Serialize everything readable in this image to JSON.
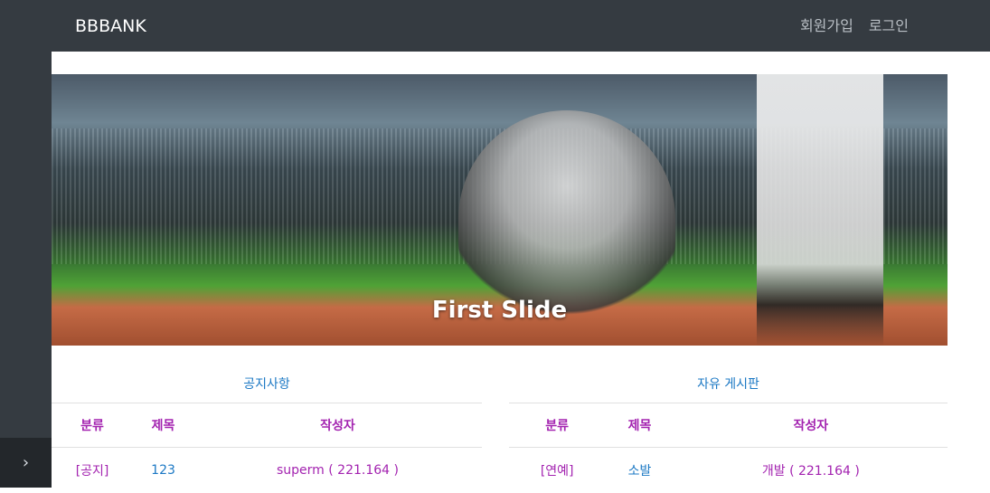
{
  "navbar": {
    "brand": "BBBANK",
    "links": [
      "회원가입",
      "로그인"
    ]
  },
  "sidebar": {
    "toggle_icon": "chevron-right-icon",
    "toggle_glyph": "›"
  },
  "carousel": {
    "caption": "First Slide"
  },
  "boards": [
    {
      "title": "공지사항",
      "columns": [
        "분류",
        "제목",
        "작성자"
      ],
      "rows": [
        {
          "category": "[공지]",
          "title": "123",
          "author": "superm ( 221.164 )"
        }
      ]
    },
    {
      "title": "자유 게시판",
      "columns": [
        "분류",
        "제목",
        "작성자"
      ],
      "rows": [
        {
          "category": "[연예]",
          "title": "소발",
          "author": "개발 ( 221.164 )"
        }
      ]
    }
  ],
  "colors": {
    "navbar_bg": "#353b41",
    "link_blue": "#1b78c4",
    "accent_purple": "#a323b0"
  }
}
